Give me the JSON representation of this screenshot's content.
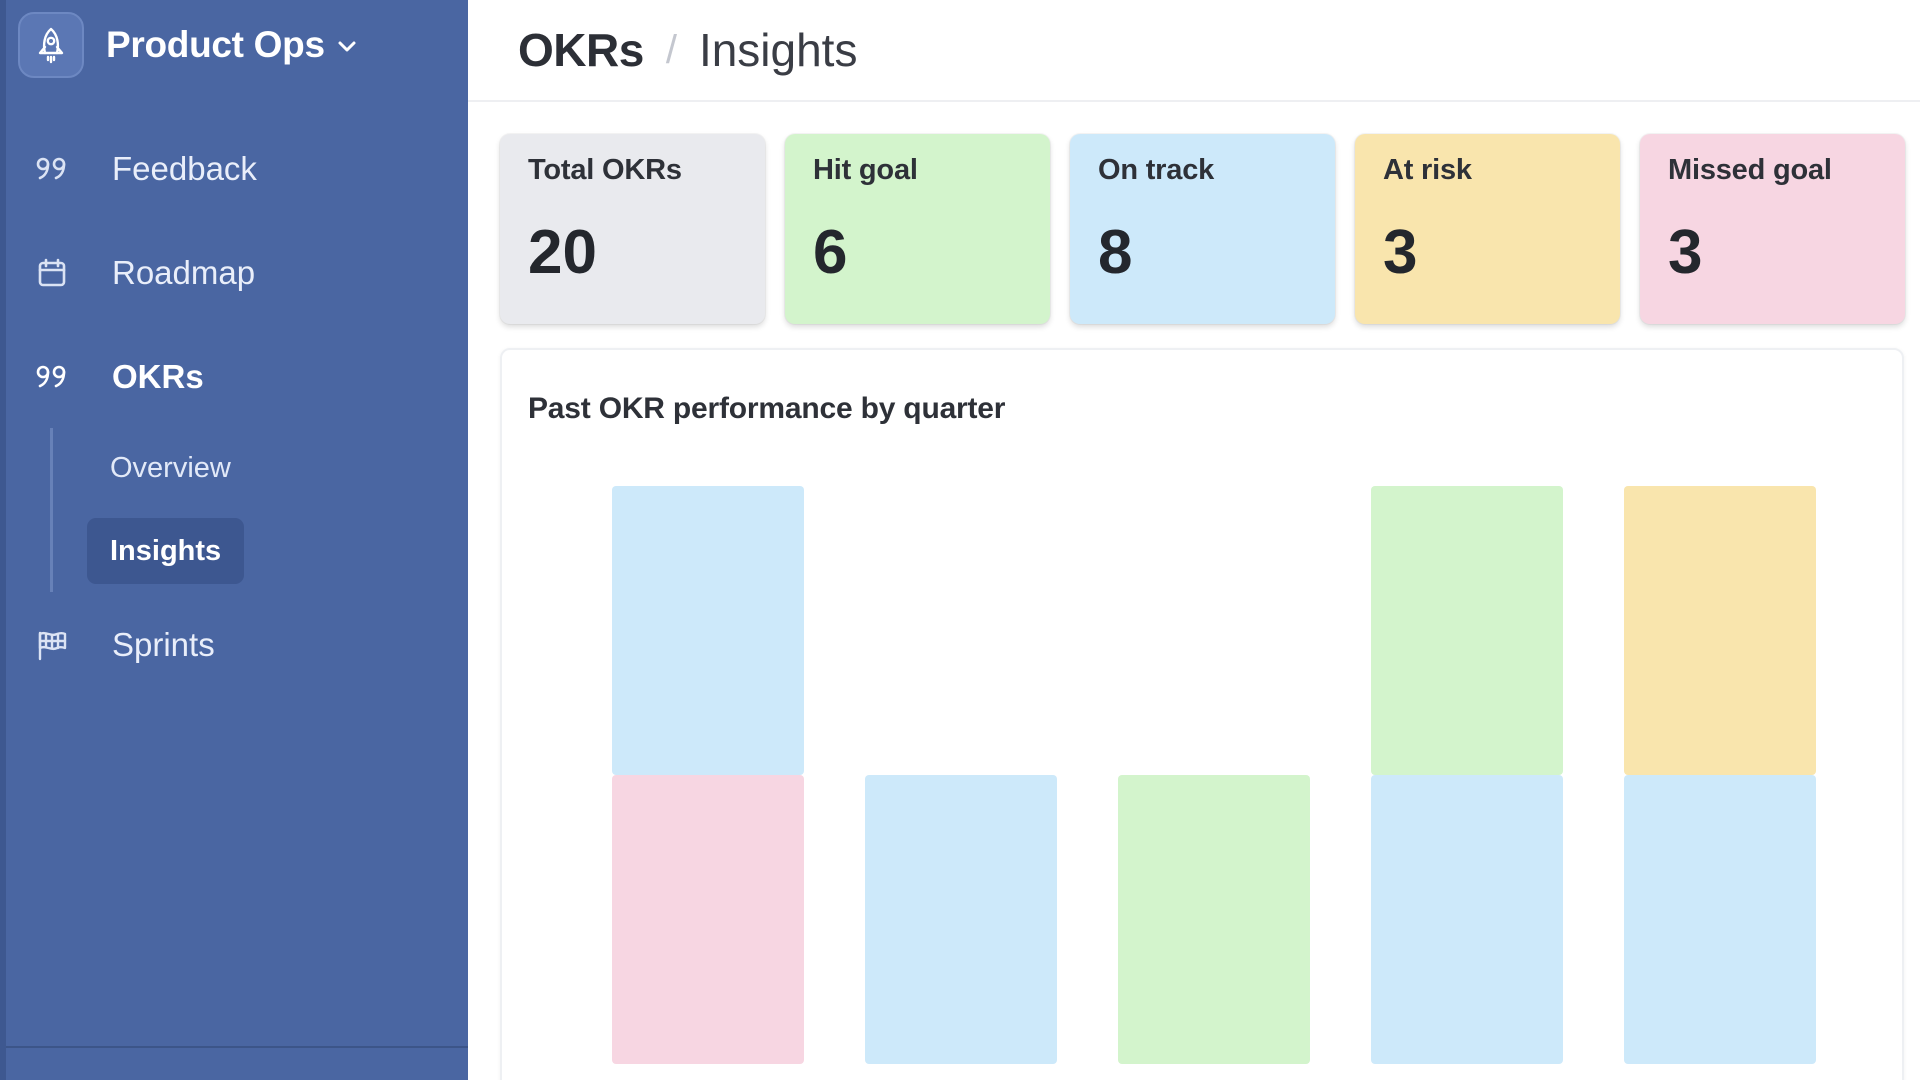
{
  "sidebar": {
    "workspace_name": "Product Ops",
    "items": [
      {
        "label": "Feedback",
        "icon": "quote-icon"
      },
      {
        "label": "Roadmap",
        "icon": "calendar-icon"
      },
      {
        "label": "OKRs",
        "icon": "quote-icon",
        "active": true
      },
      {
        "label": "Sprints",
        "icon": "flag-icon"
      }
    ],
    "okr_subitems": [
      {
        "label": "Overview"
      },
      {
        "label": "Insights",
        "active": true
      }
    ]
  },
  "breadcrumb": {
    "root": "OKRs",
    "separator": "/",
    "current": "Insights"
  },
  "stats": [
    {
      "label": "Total OKRs",
      "value": "20",
      "color": "#e9eaee"
    },
    {
      "label": "Hit goal",
      "value": "6",
      "color": "#d3f4cc"
    },
    {
      "label": "On track",
      "value": "8",
      "color": "#cde9fa"
    },
    {
      "label": "At risk",
      "value": "3",
      "color": "#f9e5ad"
    },
    {
      "label": "Missed goal",
      "value": "3",
      "color": "#f7d6e2"
    }
  ],
  "chart_title": "Past OKR performance by quarter",
  "colors": {
    "sidebar_bg": "#4a66a2",
    "hit_goal": "#d3f4cc",
    "on_track": "#cde9fa",
    "at_risk": "#f9e5ad",
    "missed_goal": "#f7d6e2"
  },
  "chart_data": {
    "type": "bar",
    "stacked": true,
    "title": "Past OKR performance by quarter",
    "xlabel": "",
    "ylabel": "",
    "ylim": [
      0,
      2
    ],
    "bars": [
      {
        "segments": [
          {
            "status": "missed_goal",
            "value": 1
          },
          {
            "status": "on_track",
            "value": 1
          }
        ]
      },
      {
        "segments": [
          {
            "status": "on_track",
            "value": 1
          }
        ]
      },
      {
        "segments": [
          {
            "status": "hit_goal",
            "value": 1
          }
        ]
      },
      {
        "segments": [
          {
            "status": "on_track",
            "value": 1
          },
          {
            "status": "hit_goal",
            "value": 1
          }
        ]
      },
      {
        "segments": [
          {
            "status": "on_track",
            "value": 1
          },
          {
            "status": "at_risk",
            "value": 1
          }
        ]
      }
    ]
  }
}
